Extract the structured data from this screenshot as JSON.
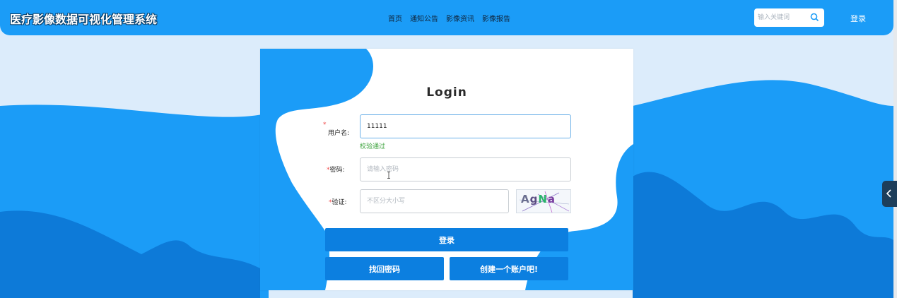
{
  "header": {
    "title": "医疗影像数据可视化管理系统",
    "nav": [
      "首页",
      "通知公告",
      "影像资讯",
      "影像报告"
    ],
    "search_placeholder": "输入关键词",
    "login_link": "登录"
  },
  "login": {
    "title": "Login",
    "username": {
      "label": "用户名:",
      "value": "11111",
      "hint": "校验通过"
    },
    "password": {
      "label": "密码:",
      "placeholder": "请输入密码"
    },
    "captcha": {
      "label": "验证:",
      "placeholder": "不区分大小写",
      "code": [
        "A",
        "g",
        "N",
        "a"
      ]
    },
    "login_button": "登录",
    "forgot_button": "找回密码",
    "register_button": "创建一个账户吧!"
  },
  "colors": {
    "accent": "#1b9cf7",
    "button": "#0c7fe0",
    "background": "#dcecfb",
    "success": "#3fa43f",
    "required": "#f04848"
  }
}
